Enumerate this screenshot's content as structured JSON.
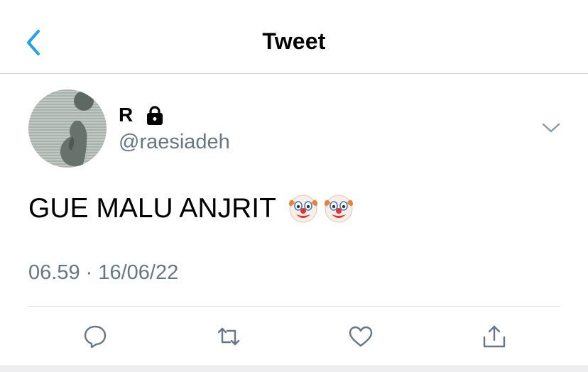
{
  "header": {
    "title": "Tweet"
  },
  "tweet": {
    "author_name": "R",
    "handle": "@raesiadeh",
    "text": "GUE MALU ANJRIT",
    "emojis": [
      "clown-face-icon",
      "clown-face-icon"
    ],
    "timestamp": "06.59 · 16/06/22",
    "protected": true
  },
  "actions": [
    "reply-icon",
    "retweet-icon",
    "like-icon",
    "share-icon"
  ],
  "colors": {
    "accent": "#1da1f2",
    "secondary_text": "#657786",
    "divider": "#d6d6d9"
  }
}
